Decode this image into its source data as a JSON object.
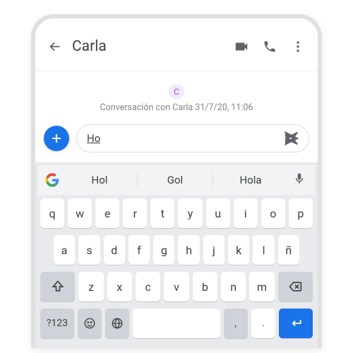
{
  "header": {
    "title": "Carla",
    "back_icon": "arrow-back",
    "video_icon": "videocam",
    "call_icon": "phone",
    "more_icon": "more-vert"
  },
  "conversation": {
    "avatar_letter": "C",
    "info_text": "Conversación con Carla 31/7/20, 11:06"
  },
  "composer": {
    "add_icon": "plus",
    "input_value": "Ho",
    "send_icon": "send"
  },
  "keyboard": {
    "logo": "G",
    "suggestions": [
      "Hol",
      "Gol",
      "Hola"
    ],
    "mic_icon": "mic",
    "row1": [
      "q",
      "w",
      "e",
      "r",
      "t",
      "y",
      "u",
      "i",
      "o",
      "p"
    ],
    "row2": [
      "a",
      "s",
      "d",
      "f",
      "g",
      "h",
      "j",
      "k",
      "l",
      "ñ"
    ],
    "row3_keys": [
      "z",
      "x",
      "c",
      "v",
      "b",
      "n",
      "m"
    ],
    "shift_icon": "shift",
    "backspace_icon": "backspace",
    "bottom": {
      "symbols": "?123",
      "emoji_icon": "emoji",
      "globe_icon": "globe",
      "comma": ",",
      "period": ".",
      "enter_icon": "enter"
    }
  }
}
